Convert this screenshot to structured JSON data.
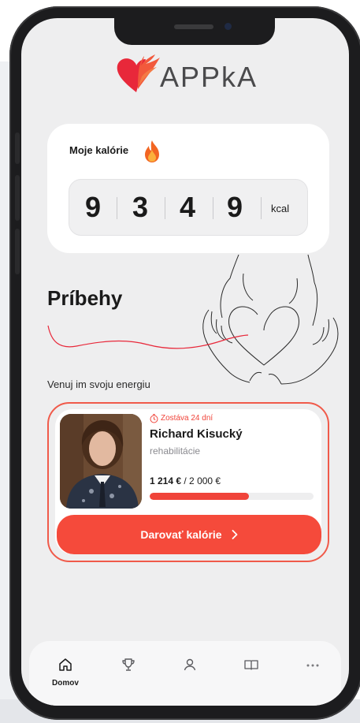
{
  "app": {
    "name": "APPkA"
  },
  "calories": {
    "title": "Moje kalórie",
    "digits": [
      "9",
      "3",
      "4",
      "9"
    ],
    "unit": "kcal"
  },
  "stories": {
    "title": "Príbehy",
    "subtitle": "Venuj im svoju energiu"
  },
  "story_card": {
    "countdown": "Zostáva 24 dní",
    "name": "Richard Kisucký",
    "category": "rehabilitácie",
    "raised": "1 214 €",
    "goal": "/ 2 000 €",
    "progress_fraction": 0.607,
    "donate_label": "Darovať kalórie",
    "accent_color": "#f0443a"
  },
  "tabbar": {
    "items": [
      {
        "icon": "home-icon",
        "label": "Domov",
        "active": true
      },
      {
        "icon": "trophy-icon"
      },
      {
        "icon": "user-icon"
      },
      {
        "icon": "book-icon"
      },
      {
        "icon": "more-icon"
      }
    ]
  }
}
